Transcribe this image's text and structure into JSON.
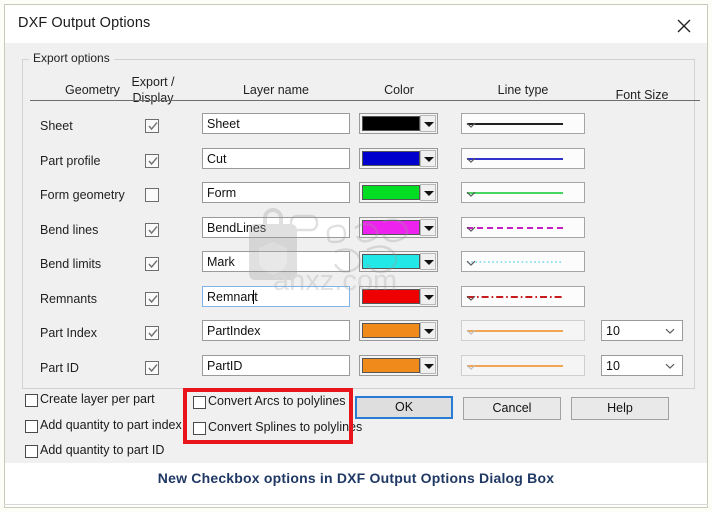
{
  "window": {
    "title": "DXF Output Options",
    "close_icon": "close-icon"
  },
  "group": {
    "legend": "Export options"
  },
  "table": {
    "headers": {
      "geometry": "Geometry",
      "export_display_line1": "Export /",
      "export_display_line2": "Display",
      "layer_name": "Layer name",
      "color": "Color",
      "line_type": "Line type",
      "font_size": "Font Size"
    },
    "rows": [
      {
        "geometry": "Sheet",
        "checked": true,
        "layer_name": "Sheet",
        "color": "#000000",
        "line_style": "solid",
        "line_color": "#000000",
        "line_disabled": false,
        "font_size": null,
        "focused": false
      },
      {
        "geometry": "Part profile",
        "checked": true,
        "layer_name": "Cut",
        "color": "#0000cc",
        "line_style": "solid",
        "line_color": "#1414c8",
        "line_disabled": false,
        "font_size": null,
        "focused": false
      },
      {
        "geometry": "Form geometry",
        "checked": false,
        "layer_name": "Form",
        "color": "#00dd22",
        "line_style": "solid",
        "line_color": "#2bd24a",
        "line_disabled": false,
        "font_size": null,
        "focused": false
      },
      {
        "geometry": "Bend lines",
        "checked": true,
        "layer_name": "BendLines",
        "color": "#ee22ee",
        "line_style": "dashed",
        "line_color": "#c41fc4",
        "line_disabled": false,
        "font_size": null,
        "focused": false
      },
      {
        "geometry": "Bend limits",
        "checked": true,
        "layer_name": "Mark",
        "color": "#22e8e8",
        "line_style": "dotted",
        "line_color": "#6fd8e8",
        "line_disabled": false,
        "font_size": null,
        "focused": false
      },
      {
        "geometry": "Remnants",
        "checked": true,
        "layer_name": "Remnant",
        "color": "#ee0000",
        "line_style": "dashdot",
        "line_color": "#c71a1a",
        "line_disabled": false,
        "font_size": null,
        "focused": true
      },
      {
        "geometry": "Part Index",
        "checked": true,
        "layer_name": "PartIndex",
        "color": "#f08a1a",
        "line_style": "solid",
        "line_color": "#f0922a",
        "line_disabled": true,
        "font_size": "10",
        "focused": false
      },
      {
        "geometry": "Part ID",
        "checked": true,
        "layer_name": "PartID",
        "color": "#f08a1a",
        "line_style": "solid",
        "line_color": "#f0922a",
        "line_disabled": true,
        "font_size": "10",
        "focused": false
      }
    ]
  },
  "options_left": [
    {
      "label": "Create layer per part",
      "checked": false
    },
    {
      "label": "Add quantity to part index",
      "checked": false
    },
    {
      "label": "Add quantity to part ID",
      "checked": false
    }
  ],
  "options_highlighted": [
    {
      "label": "Convert Arcs to polylines",
      "checked": false
    },
    {
      "label": "Convert Splines to polylines",
      "checked": false
    }
  ],
  "highlight": {
    "color": "#e8161c"
  },
  "buttons": {
    "ok": "OK",
    "cancel": "Cancel",
    "help": "Help"
  },
  "caption": {
    "text": "New Checkbox options in DXF Output Options Dialog Box",
    "color": "#1f3864"
  },
  "watermark": {
    "text": "anxz.com",
    "badge_icon": "shield-lock-icon"
  }
}
